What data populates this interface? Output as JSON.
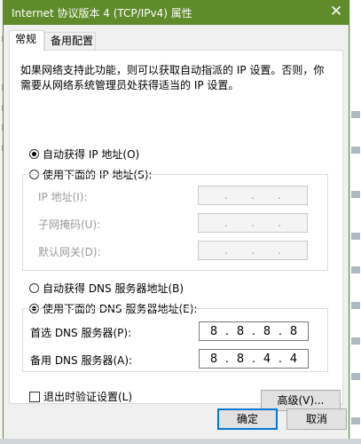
{
  "window": {
    "title": "Internet 协议版本 4 (TCP/IPv4) 属性",
    "accent_color": "#5f8b2b"
  },
  "tabs": [
    {
      "label": "常规",
      "active": true
    },
    {
      "label": "备用配置",
      "active": false
    }
  ],
  "description": "如果网络支持此功能，则可以获取自动指派的 IP 设置。否则，你需要从网络系统管理员处获得适当的 IP 设置。",
  "ip": {
    "auto_label": "自动获得 IP 地址(O)",
    "auto_selected": true,
    "manual_label": "使用下面的 IP 地址(S):",
    "manual_selected": false,
    "fields": [
      {
        "label": "IP 地址(I):",
        "octets": [
          "",
          "",
          "",
          ""
        ]
      },
      {
        "label": "子网掩码(U):",
        "octets": [
          "",
          "",
          "",
          ""
        ]
      },
      {
        "label": "默认网关(D):",
        "octets": [
          "",
          "",
          "",
          ""
        ]
      }
    ]
  },
  "dns": {
    "auto_label": "自动获得 DNS 服务器地址(B)",
    "auto_selected": false,
    "manual_label": "使用下面的 DNS 服务器地址(E):",
    "manual_selected": true,
    "preferred": {
      "label": "首选 DNS 服务器(P):",
      "octets": [
        "8",
        "8",
        "8",
        "8"
      ]
    },
    "alternate": {
      "label": "备用 DNS 服务器(A):",
      "octets": [
        "8",
        "8",
        "4",
        "4"
      ]
    }
  },
  "validate": {
    "label": "退出时验证设置(L)",
    "checked": false
  },
  "buttons": {
    "advanced": "高级(V)...",
    "ok": "确定",
    "cancel": "取消"
  },
  "icons": {
    "close": "close-icon"
  }
}
